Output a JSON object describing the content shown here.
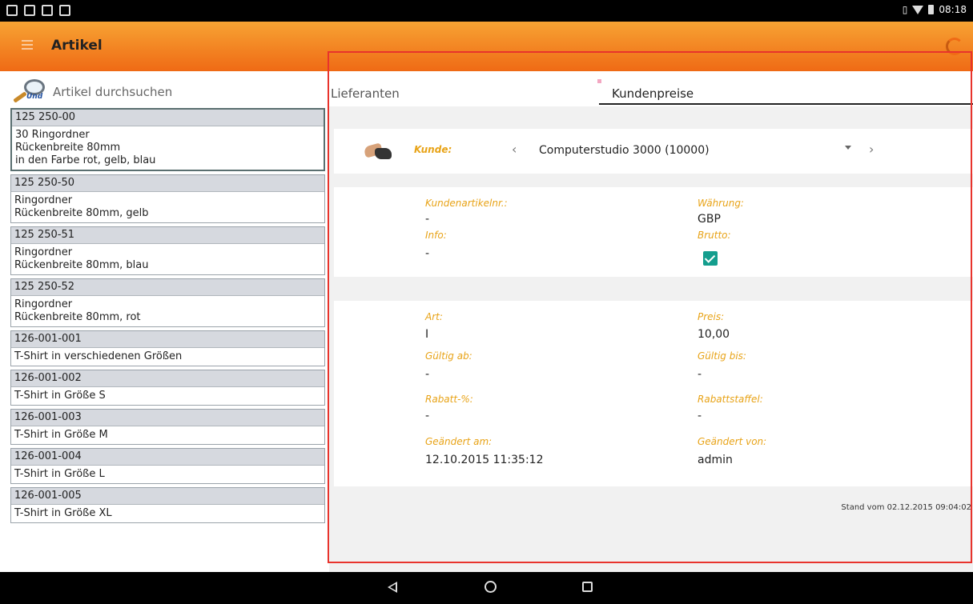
{
  "status_bar": {
    "time": "08:18"
  },
  "app_bar": {
    "title": "Artikel"
  },
  "search": {
    "placeholder": "Artikel durchsuchen",
    "icon_label": "Und"
  },
  "articles": [
    {
      "number": "125 250-00",
      "lines": [
        "30 Ringordner",
        "Rückenbreite 80mm",
        "in den Farbe rot, gelb, blau"
      ]
    },
    {
      "number": "125 250-50",
      "lines": [
        "Ringordner",
        "Rückenbreite 80mm, gelb"
      ]
    },
    {
      "number": "125 250-51",
      "lines": [
        "Ringordner",
        "Rückenbreite 80mm, blau"
      ]
    },
    {
      "number": "125 250-52",
      "lines": [
        "Ringordner",
        "Rückenbreite 80mm, rot"
      ]
    },
    {
      "number": "126-001-001",
      "lines": [
        "T-Shirt in verschiedenen Größen"
      ]
    },
    {
      "number": "126-001-002",
      "lines": [
        "T-Shirt in Größe S"
      ]
    },
    {
      "number": "126-001-003",
      "lines": [
        "T-Shirt in Größe M"
      ]
    },
    {
      "number": "126-001-004",
      "lines": [
        "T-Shirt in Größe L"
      ]
    },
    {
      "number": "126-001-005",
      "lines": [
        "T-Shirt in Größe XL"
      ]
    }
  ],
  "tabs": {
    "lieferanten": "Lieferanten",
    "kundenpreise": "Kundenpreise"
  },
  "customer": {
    "label": "Kunde:",
    "value": "Computerstudio 3000 (10000)"
  },
  "details": {
    "kundenartikelnr_label": "Kundenartikelnr.:",
    "kundenartikelnr_value": "-",
    "waehrung_label": "Währung:",
    "waehrung_value": "GBP",
    "info_label": "Info:",
    "info_value": "-",
    "brutto_label": "Brutto:",
    "brutto_checked": true
  },
  "pricing": {
    "art_label": "Art:",
    "art_value": "I",
    "preis_label": "Preis:",
    "preis_value": "10,00",
    "gueltig_ab_label": "Gültig ab:",
    "gueltig_ab_value": "-",
    "gueltig_bis_label": "Gültig bis:",
    "gueltig_bis_value": "-",
    "rabatt_label": "Rabatt-%:",
    "rabatt_value": "-",
    "rabattstaffel_label": "Rabattstaffel:",
    "rabattstaffel_value": "-",
    "geaendert_am_label": "Geändert am:",
    "geaendert_am_value": "12.10.2015 11:35:12",
    "geaendert_von_label": "Geändert von:",
    "geaendert_von_value": "admin"
  },
  "footer": {
    "stand": "Stand vom 02.12.2015 09:04:02"
  },
  "colors": {
    "accent": "#ef6a15",
    "label": "#e8a317",
    "check": "#149e8e",
    "highlight": "#e8332c"
  }
}
